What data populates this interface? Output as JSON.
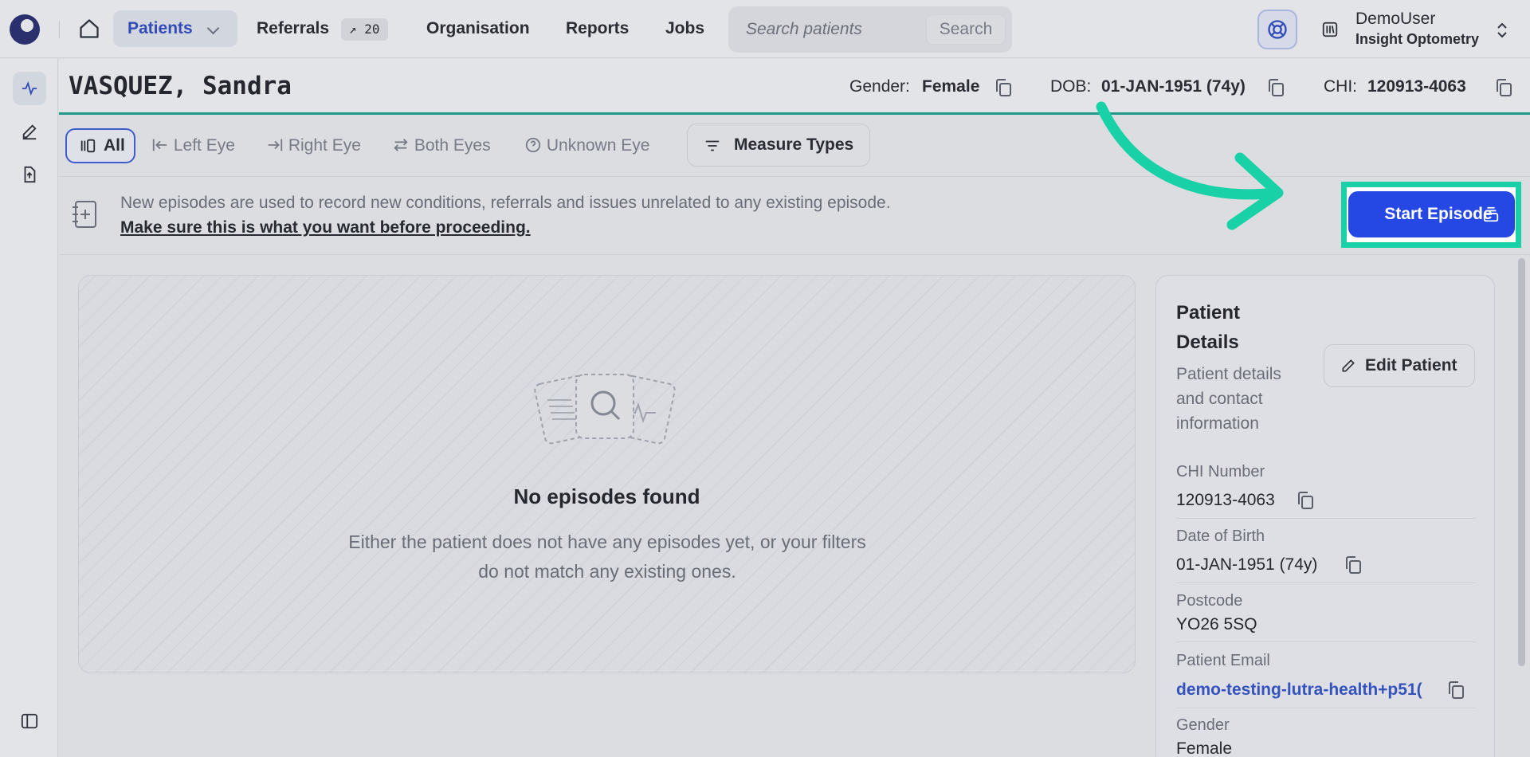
{
  "nav": {
    "patients": "Patients",
    "referrals": "Referrals",
    "referrals_badge": "↗ 20",
    "organisation": "Organisation",
    "reports": "Reports",
    "jobs": "Jobs",
    "search_placeholder": "Search patients",
    "search_button": "Search"
  },
  "user": {
    "name": "DemoUser",
    "organisation": "Insight Optometry"
  },
  "patient": {
    "name": "VASQUEZ, Sandra",
    "gender_label": "Gender:",
    "gender": "Female",
    "dob_label": "DOB:",
    "dob": "01-JAN-1951 (74y)",
    "chi_label": "CHI:",
    "chi": "120913-4063"
  },
  "filters": {
    "all": "All",
    "left_eye": "Left Eye",
    "right_eye": "Right Eye",
    "both_eyes": "Both Eyes",
    "unknown_eye": "Unknown Eye",
    "measure_types": "Measure Types"
  },
  "notice": {
    "text": "New episodes are used to record new conditions, referrals and issues unrelated to any existing episode.",
    "link": "Make sure this is what you want before proceeding.",
    "start_button": "Start Episode"
  },
  "empty": {
    "title": "No episodes found",
    "subtitle": "Either the patient does not have any episodes yet, or your filters do not match any existing ones."
  },
  "details": {
    "title": "Patient Details",
    "subtitle": "Patient details and contact information",
    "edit_button": "Edit Patient",
    "chi_label": "CHI Number",
    "chi_value": "120913-4063",
    "dob_label": "Date of Birth",
    "dob_value": "01-JAN-1951 (74y)",
    "postcode_label": "Postcode",
    "postcode_value": "YO26 5SQ",
    "email_label": "Patient Email",
    "email_value": "demo-testing-lutra-health+p51(",
    "gender_label": "Gender",
    "gender_value": "Female"
  },
  "colors": {
    "accent": "#2548e5",
    "highlight": "#19d1a6",
    "teal_rule": "#17a58f"
  }
}
